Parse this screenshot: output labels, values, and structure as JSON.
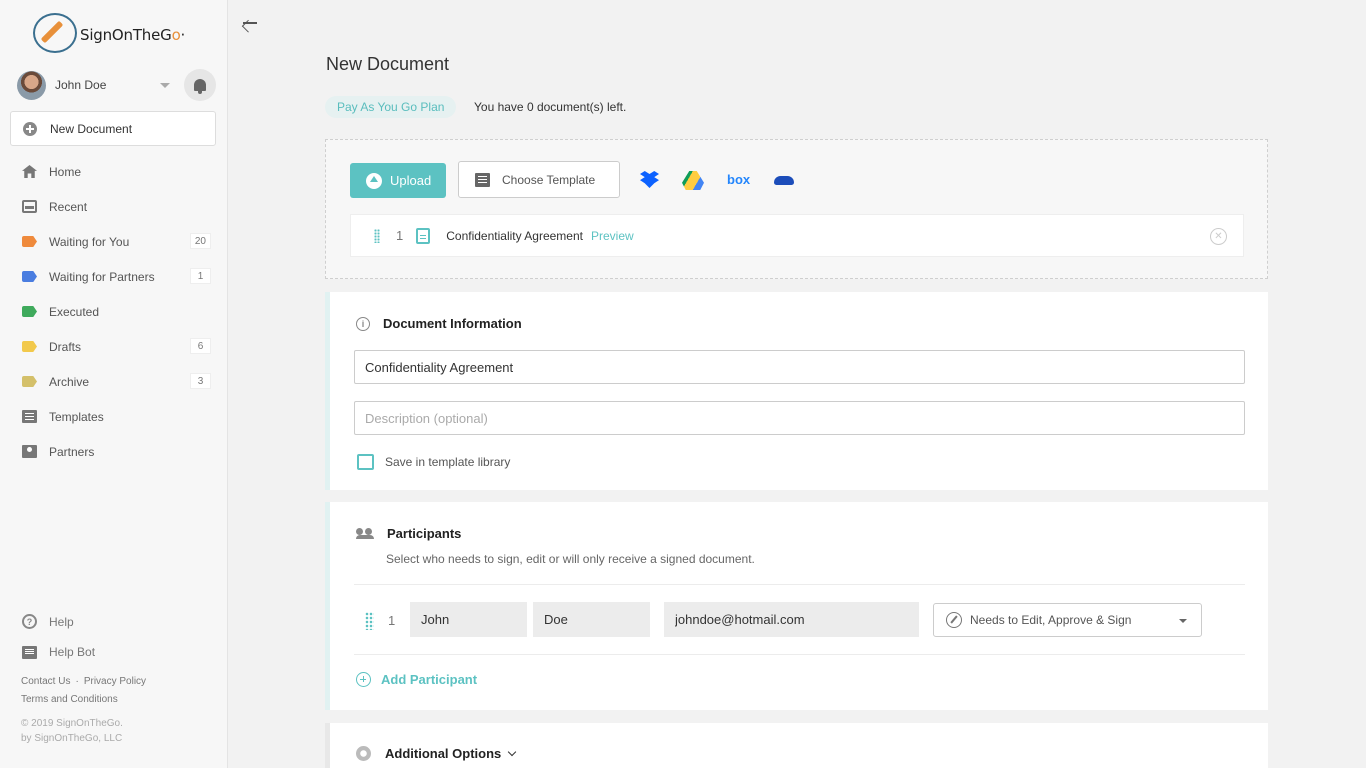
{
  "brand": {
    "name_main": "SignOnTheG",
    "name_accent": "o"
  },
  "user": {
    "name": "John Doe"
  },
  "sidebar": {
    "new_document": "New Document",
    "items": [
      {
        "label": "Home",
        "icon": "home-icon",
        "badge": ""
      },
      {
        "label": "Recent",
        "icon": "inbox-icon",
        "badge": ""
      },
      {
        "label": "Waiting for You",
        "icon": "tag-orange-icon",
        "color": "#ef8a3c",
        "badge": "20"
      },
      {
        "label": "Waiting for Partners",
        "icon": "tag-blue-icon",
        "color": "#4a7de0",
        "badge": "1"
      },
      {
        "label": "Executed",
        "icon": "tag-green-icon",
        "color": "#3faa5c",
        "badge": ""
      },
      {
        "label": "Drafts",
        "icon": "tag-yellow-icon",
        "color": "#f2c94c",
        "badge": "6"
      },
      {
        "label": "Archive",
        "icon": "tag-khaki-icon",
        "color": "#d4c06a",
        "badge": "3"
      },
      {
        "label": "Templates",
        "icon": "template-icon",
        "badge": ""
      },
      {
        "label": "Partners",
        "icon": "partners-icon",
        "badge": ""
      }
    ],
    "help": "Help",
    "help_bot": "Help Bot",
    "contact": "Contact Us",
    "privacy": "Privacy Policy",
    "terms": "Terms and Conditions",
    "copyright1": "© 2019 SignOnTheGo.",
    "copyright2": "by SignOnTheGo, LLC"
  },
  "main": {
    "title": "New Document",
    "plan": "Pay As You Go Plan",
    "plan_status": "You have 0 document(s) left.",
    "upload_label": "Upload",
    "choose_template_label": "Choose Template",
    "box_label": "box",
    "document": {
      "index": "1",
      "name": "Confidentiality Agreement",
      "preview": "Preview"
    }
  },
  "doc_info": {
    "heading": "Document Information",
    "name_value": "Confidentiality Agreement",
    "description_placeholder": "Description (optional)",
    "save_template_label": "Save in template library"
  },
  "participants": {
    "heading": "Participants",
    "subtitle": "Select who needs to sign, edit or will only receive a signed document.",
    "rows": [
      {
        "index": "1",
        "first": "John",
        "last": "Doe",
        "email": "johndoe@hotmail.com",
        "role": "Needs to Edit, Approve & Sign"
      }
    ],
    "add_label": "Add Participant"
  },
  "options": {
    "heading": "Additional Options"
  },
  "colors": {
    "accent": "#5cc2c2",
    "plan_bg": "#e6f1f1"
  }
}
